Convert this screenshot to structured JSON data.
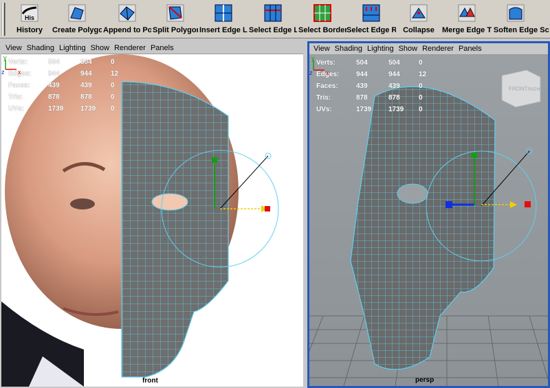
{
  "shelf": {
    "tools": [
      {
        "top": "His",
        "label": "History"
      },
      {
        "label": "Create Polygo"
      },
      {
        "label": "Append to Pol"
      },
      {
        "label": "Split Polygon"
      },
      {
        "label": "Insert Edge Lc"
      },
      {
        "label": "Select Edge L"
      },
      {
        "label": "Select Border"
      },
      {
        "label": "Select Edge R"
      },
      {
        "label": "Collapse"
      },
      {
        "label": "Merge Edge T"
      },
      {
        "label": "Soften Edge"
      },
      {
        "label": "Sc"
      }
    ]
  },
  "menu": [
    "View",
    "Shading",
    "Lighting",
    "Show",
    "Renderer",
    "Panels"
  ],
  "hud": {
    "rows": [
      {
        "key": "Verts:",
        "v1": "504",
        "v2": "504",
        "v3": "0"
      },
      {
        "key": "Edges:",
        "v1": "944",
        "v2": "944",
        "v3": "12"
      },
      {
        "key": "Faces:",
        "v1": "439",
        "v2": "439",
        "v3": "0"
      },
      {
        "key": "Tris:",
        "v1": "878",
        "v2": "878",
        "v3": "0"
      },
      {
        "key": "UVs:",
        "v1": "1739",
        "v2": "1739",
        "v3": "0"
      }
    ]
  },
  "viewports": {
    "front": {
      "camera": "front"
    },
    "persp": {
      "camera": "persp",
      "viewcube_front": "FRONT",
      "viewcube_right": "RIGH"
    }
  },
  "axis": {
    "y": "y",
    "z": "z",
    "x": "x"
  },
  "colors": {
    "selection": "#2858b8",
    "wire": "#5fd0f0",
    "mesh": "#6a6a6a",
    "manip_red": "#e01010",
    "manip_green": "#10a010",
    "manip_blue": "#1030e0",
    "manip_yellow": "#f0d000"
  }
}
